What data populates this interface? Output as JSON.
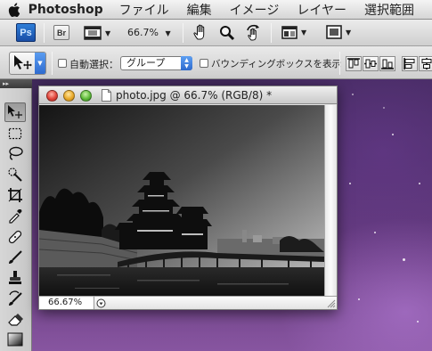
{
  "menubar": {
    "app_name": "Photoshop",
    "menus": [
      "ファイル",
      "編集",
      "イメージ",
      "レイヤー",
      "選択範囲"
    ]
  },
  "appbar": {
    "ps_label": "Ps",
    "bridge_label": "Br",
    "zoom": "66.7%"
  },
  "options": {
    "auto_select_label": "自動選択：",
    "auto_select_value": "グループ",
    "auto_select_checked": false,
    "bounding_box_label": "バウンディングボックスを表示",
    "bounding_box_checked": false
  },
  "document": {
    "title": "photo.jpg @ 66.7% (RGB/8) *",
    "status_zoom": "66.67%",
    "image_description": "black-and-white photo of Matsumoto Castle with red bridge reflected in moat"
  },
  "tools": [
    "move-tool",
    "marquee-tool",
    "lasso-tool",
    "quick-selection-tool",
    "crop-tool",
    "eyedropper-tool",
    "healing-brush-tool",
    "brush-tool",
    "clone-stamp-tool",
    "history-brush-tool",
    "eraser-tool",
    "gradient-tool"
  ],
  "colors": {
    "ps_blue": "#1a4ea6",
    "close_red": "#e0443a",
    "minimize_yellow": "#e9a92a",
    "zoom_green": "#5fbb3a",
    "desktop_purple": "#4b2f66"
  }
}
